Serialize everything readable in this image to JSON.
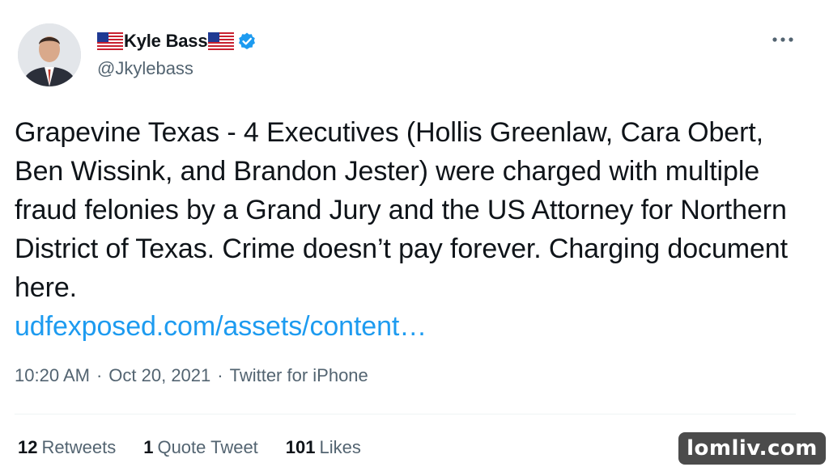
{
  "author": {
    "flag_left": "us-flag-icon",
    "display_name": "Kyle Bass",
    "flag_right": "us-flag-icon",
    "verified_icon": "verified-badge-icon",
    "handle": "@Jkylebass"
  },
  "menu_icon": "more-options-icon",
  "tweet": {
    "text": "Grapevine Texas - 4 Executives (Hollis Greenlaw, Cara Obert, Ben Wissink, and Brandon Jester) were charged with multiple fraud felonies by a Grand Jury and the US Attorney for Northern District of Texas. Crime doesn’t pay forever. Charging document here.",
    "link_text": "udfexposed.com/assets/content…"
  },
  "meta": {
    "time": "10:20 AM",
    "sep1": "·",
    "date": "Oct 20, 2021",
    "sep2": "·",
    "source": "Twitter for iPhone"
  },
  "stats": {
    "retweets_count": "12",
    "retweets_label": "Retweets",
    "quotes_count": "1",
    "quotes_label": "Quote Tweet",
    "likes_count": "101",
    "likes_label": "Likes"
  },
  "watermark": "lomliv.com",
  "colors": {
    "link": "#1d9bf0",
    "secondary_text": "#536471",
    "primary_text": "#0f1419",
    "verified": "#1d9bf0",
    "watermark_bg": "#4b4b4b"
  }
}
